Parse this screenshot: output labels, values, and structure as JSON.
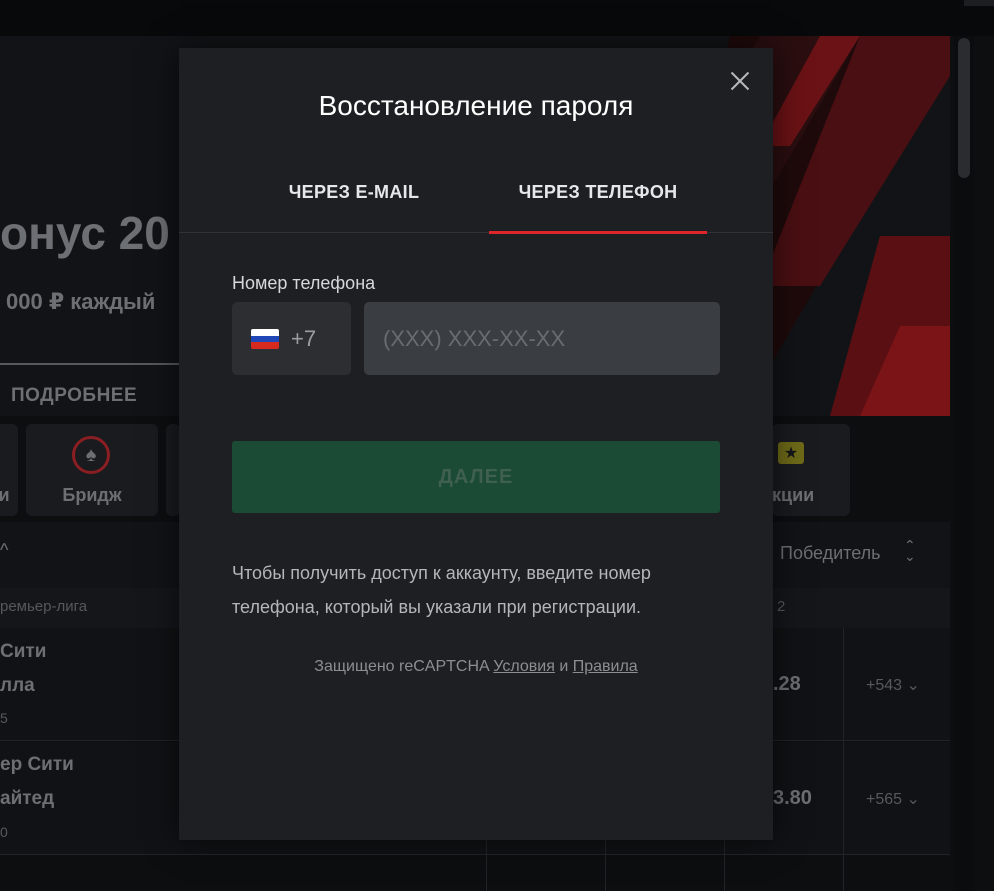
{
  "background": {
    "hero_title": "онус 20",
    "hero_subtitle": "000 ₽ каждый",
    "hero_button": "ПОДРОБНЕЕ",
    "categories": [
      {
        "label": "и"
      },
      {
        "label": "Бридж",
        "icon": "spade-icon"
      },
      {
        "label": "кции",
        "icon": "ticket-icon"
      }
    ],
    "table": {
      "winner_header": "Победитель",
      "league": "ремьер-лига",
      "league_num": "2",
      "rows": [
        {
          "team1": "Сити",
          "team2": "лла",
          "small": "5",
          "odds": ".28",
          "more": "+543"
        },
        {
          "team1": "ер Сити",
          "team2": "айтед",
          "small": "0",
          "odds": "3.80",
          "more": "+565"
        }
      ]
    },
    "accent_red": "#e0262b"
  },
  "modal": {
    "title": "Восстановление пароля",
    "tabs": [
      {
        "label": "ЧЕРЕЗ E-MAIL",
        "active": false
      },
      {
        "label": "ЧЕРЕЗ ТЕЛЕФОН",
        "active": true
      }
    ],
    "phone_label": "Номер телефона",
    "country_code": "+7",
    "country_flag": "russia-flag-icon",
    "phone_value": "",
    "phone_placeholder": "(XXX) XXX-XX-XX",
    "next_button": "ДАЛЕЕ",
    "next_button_color": "#1b4a35",
    "hint": "Чтобы получить доступ к аккаунту, введите номер телефона, который вы указали при регистрации.",
    "captcha": {
      "prefix": "Защищено reCAPTCHA",
      "terms": "Условия",
      "and": "и",
      "rules": "Правила"
    }
  }
}
